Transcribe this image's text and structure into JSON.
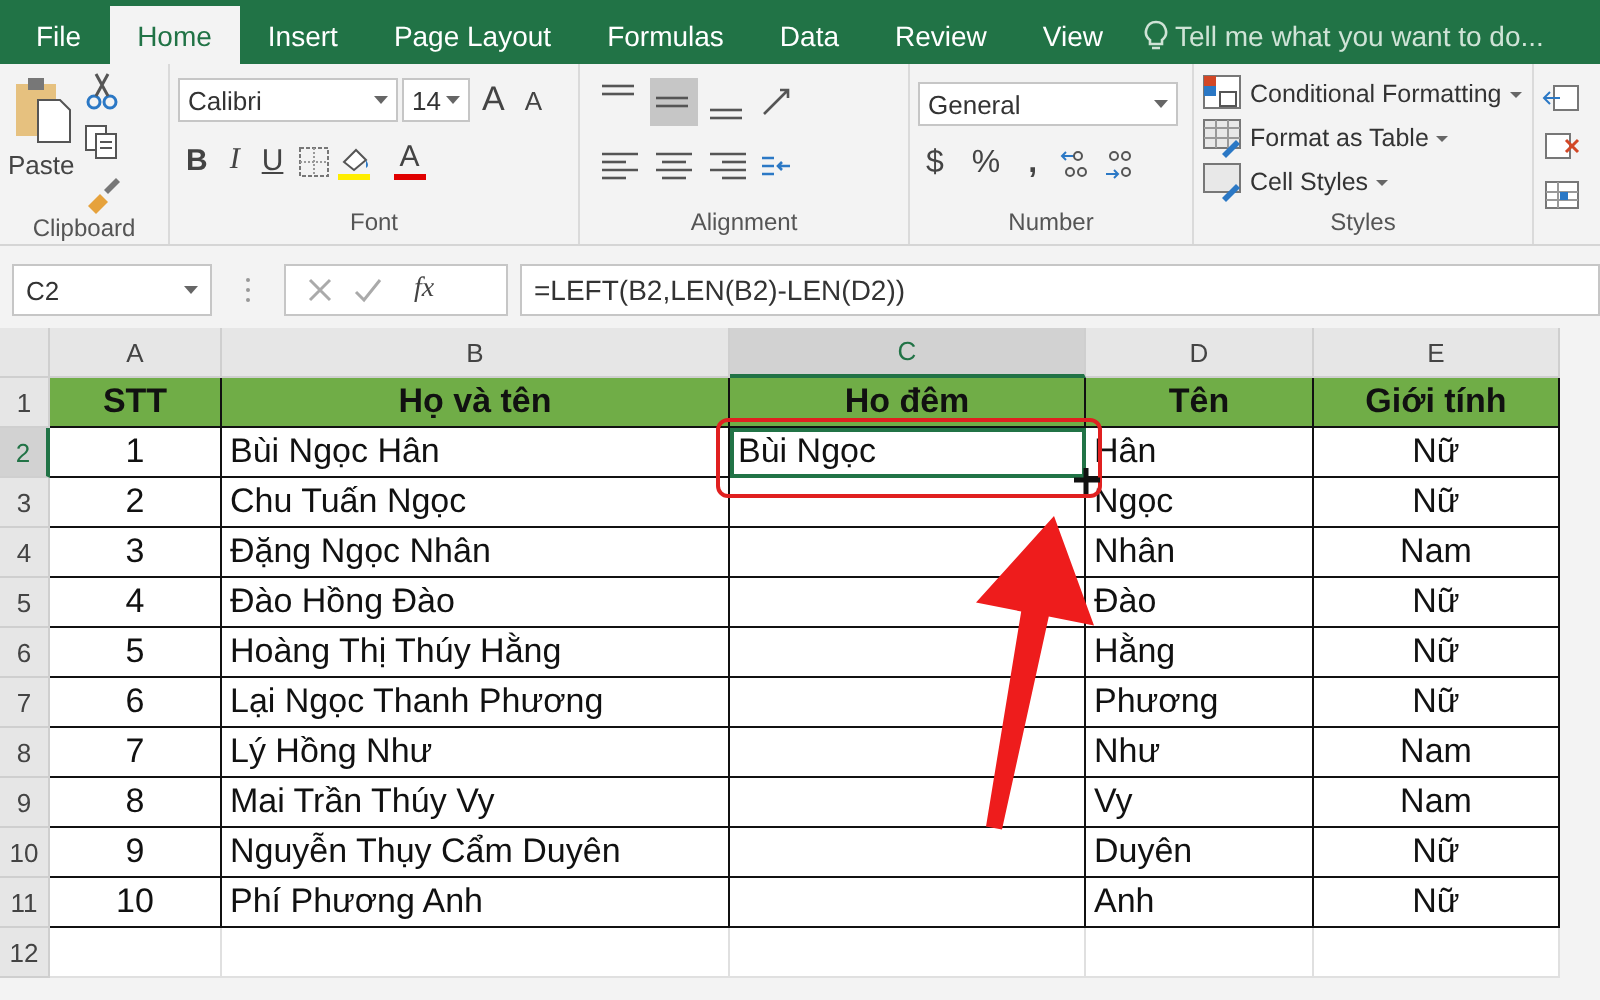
{
  "tabs": [
    {
      "label": "File",
      "selected": false
    },
    {
      "label": "Home",
      "selected": true
    },
    {
      "label": "Insert",
      "selected": false
    },
    {
      "label": "Page Layout",
      "selected": false
    },
    {
      "label": "Formulas",
      "selected": false
    },
    {
      "label": "Data",
      "selected": false
    },
    {
      "label": "Review",
      "selected": false
    },
    {
      "label": "View",
      "selected": false
    }
  ],
  "tell_me": {
    "placeholder": "Tell me what you want to do..."
  },
  "ribbon": {
    "clipboard": {
      "paste": "Paste",
      "label": "Clipboard"
    },
    "font": {
      "name": "Calibri",
      "size": "14",
      "bold": "B",
      "italic": "I",
      "underline": "U",
      "grow": "A",
      "shrink": "A",
      "font_color": "A",
      "label": "Font"
    },
    "alignment": {
      "top_row": [
        {
          "kind": "top",
          "selected": false
        },
        {
          "kind": "middle",
          "selected": true
        },
        {
          "kind": "bottom",
          "selected": false
        }
      ],
      "bottom_row": [
        {
          "kind": "left",
          "selected": false
        },
        {
          "kind": "center",
          "selected": false
        },
        {
          "kind": "right",
          "selected": false
        }
      ],
      "label": "Alignment"
    },
    "number": {
      "format": "General",
      "currency": "$",
      "percent": "%",
      "comma": ",",
      "label": "Number"
    },
    "styles": {
      "items": [
        "Conditional Formatting",
        "Format as Table",
        "Cell Styles"
      ],
      "label": "Styles"
    }
  },
  "formula_bar": {
    "name_box": "C2",
    "fx": "fx",
    "formula": "=LEFT(B2,LEN(B2)-LEN(D2))"
  },
  "sheet": {
    "columns": [
      {
        "label": "A",
        "selected": false
      },
      {
        "label": "B",
        "selected": false
      },
      {
        "label": "C",
        "selected": true
      },
      {
        "label": "D",
        "selected": false
      },
      {
        "label": "E",
        "selected": false
      }
    ],
    "rows": [
      {
        "number": "1",
        "selected": false,
        "cells": [
          "STT",
          "Họ và tên",
          "Ho đêm",
          "Tên",
          "Giới tính"
        ]
      },
      {
        "number": "2",
        "selected": true,
        "cells": [
          "1",
          "Bùi Ngọc Hân",
          "Bùi Ngọc",
          "Hân",
          "Nữ"
        ]
      },
      {
        "number": "3",
        "selected": false,
        "cells": [
          "2",
          "Chu Tuấn Ngọc",
          "",
          "Ngọc",
          "Nữ"
        ]
      },
      {
        "number": "4",
        "selected": false,
        "cells": [
          "3",
          "Đặng Ngọc Nhân",
          "",
          "Nhân",
          "Nam"
        ]
      },
      {
        "number": "5",
        "selected": false,
        "cells": [
          "4",
          "Đào Hồng Đào",
          "",
          "Đào",
          "Nữ"
        ]
      },
      {
        "number": "6",
        "selected": false,
        "cells": [
          "5",
          "Hoàng Thị Thúy Hằng",
          "",
          "Hằng",
          "Nữ"
        ]
      },
      {
        "number": "7",
        "selected": false,
        "cells": [
          "6",
          "Lại Ngọc Thanh Phương",
          "",
          "Phương",
          "Nữ"
        ]
      },
      {
        "number": "8",
        "selected": false,
        "cells": [
          "7",
          "Lý Hồng Như",
          "",
          "Như",
          "Nam"
        ]
      },
      {
        "number": "9",
        "selected": false,
        "cells": [
          "8",
          "Mai Trần Thúy Vy",
          "",
          "Vy",
          "Nam"
        ]
      },
      {
        "number": "10",
        "selected": false,
        "cells": [
          "9",
          "Nguyễn Thụy Cẩm Duyên",
          "",
          "Duyên",
          "Nữ"
        ]
      },
      {
        "number": "11",
        "selected": false,
        "cells": [
          "10",
          "Phí Phương Anh",
          "",
          "Anh",
          "Nữ"
        ]
      },
      {
        "number": "12",
        "selected": false,
        "cells": []
      }
    ]
  }
}
